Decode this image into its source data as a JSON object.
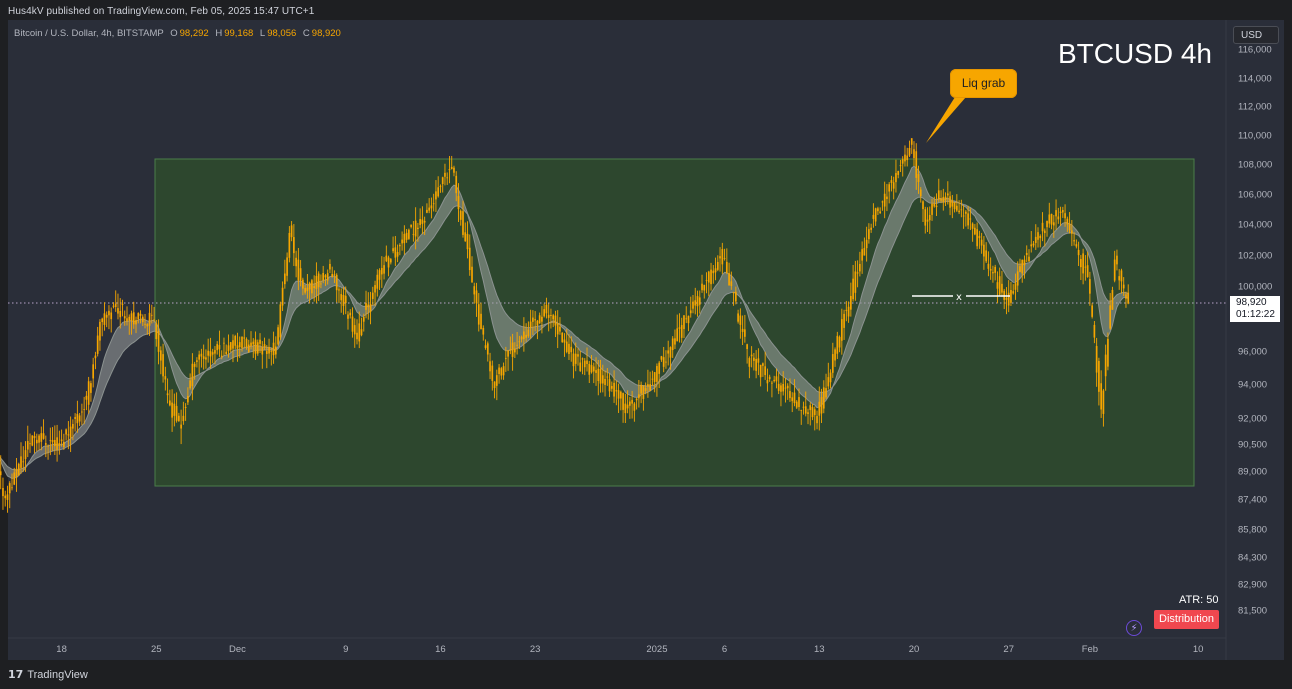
{
  "publish_bar": "Hus4kV published on TradingView.com, Feb 05, 2025 15:47 UTC+1",
  "footer_logo_text": "TradingView",
  "legend": {
    "symbol": "Bitcoin / U.S. Dollar, 4h, BITSTAMP",
    "o_key": "O",
    "o_val": "98,292",
    "h_key": "H",
    "h_val": "99,168",
    "l_key": "L",
    "l_val": "98,056",
    "c_key": "C",
    "c_val": "98,920"
  },
  "title": "BTCUSD 4h",
  "currency_button": "USD",
  "last_price": "98,920",
  "countdown": "01:12:22",
  "annotation": "Liq grab",
  "atr_label": "ATR: 50",
  "badge_label": "Distribution",
  "colors": {
    "background": "#2a2e39",
    "candle": "#f7a600",
    "range_box": "#2d4a2e",
    "range_border": "#4a7d49",
    "ma_band": "#9ca3a0",
    "callout": "#f7a600",
    "badge": "#f0474f"
  },
  "chart_data": {
    "type": "candlestick",
    "title": "BTCUSD 4h",
    "y_axis_ticks": [
      "116,000",
      "114,000",
      "112,000",
      "110,000",
      "108,000",
      "106,000",
      "104,000",
      "102,000",
      "100,000",
      "96,000",
      "94,000",
      "92,000",
      "90,500",
      "89,000",
      "87,400",
      "85,800",
      "84,300",
      "82,900",
      "81,500"
    ],
    "x_axis_ticks": [
      "18",
      "25",
      "Dec",
      "9",
      "16",
      "23",
      "2025",
      "6",
      "13",
      "20",
      "27",
      "Feb",
      "10"
    ],
    "range_box": {
      "low": 88300,
      "high": 108400,
      "start": "Nov 25",
      "end": "Feb 10"
    },
    "liq_grab_high": 109300,
    "swing_low_line": {
      "price": 99000,
      "start": "Jan 20",
      "end": "Jan 27"
    },
    "last_close": 98920,
    "price_path": [
      {
        "date": "Nov 13",
        "price": 90000
      },
      {
        "date": "Nov 14",
        "price": 87500
      },
      {
        "date": "Nov 16",
        "price": 91000
      },
      {
        "date": "Nov 18",
        "price": 90500
      },
      {
        "date": "Nov 20",
        "price": 93000
      },
      {
        "date": "Nov 21",
        "price": 97500
      },
      {
        "date": "Nov 22",
        "price": 98800
      },
      {
        "date": "Nov 24",
        "price": 97800
      },
      {
        "date": "Nov 25",
        "price": 98000
      },
      {
        "date": "Nov 26",
        "price": 93000
      },
      {
        "date": "Nov 27",
        "price": 91500
      },
      {
        "date": "Nov 28",
        "price": 95500
      },
      {
        "date": "Dec 01",
        "price": 96500
      },
      {
        "date": "Dec 04",
        "price": 96000
      },
      {
        "date": "Dec 05",
        "price": 103500
      },
      {
        "date": "Dec 06",
        "price": 99500
      },
      {
        "date": "Dec 08",
        "price": 101000
      },
      {
        "date": "Dec 10",
        "price": 97000
      },
      {
        "date": "Dec 12",
        "price": 101500
      },
      {
        "date": "Dec 15",
        "price": 104500
      },
      {
        "date": "Dec 17",
        "price": 107800
      },
      {
        "date": "Dec 19",
        "price": 98000
      },
      {
        "date": "Dec 20",
        "price": 94000
      },
      {
        "date": "Dec 22",
        "price": 97000
      },
      {
        "date": "Dec 24",
        "price": 98500
      },
      {
        "date": "Dec 26",
        "price": 95500
      },
      {
        "date": "Dec 28",
        "price": 94500
      },
      {
        "date": "Dec 30",
        "price": 92500
      },
      {
        "date": "Jan 01",
        "price": 94500
      },
      {
        "date": "Jan 03",
        "price": 97500
      },
      {
        "date": "Jan 06",
        "price": 102000
      },
      {
        "date": "Jan 08",
        "price": 95500
      },
      {
        "date": "Jan 10",
        "price": 94000
      },
      {
        "date": "Jan 13",
        "price": 92000
      },
      {
        "date": "Jan 15",
        "price": 98000
      },
      {
        "date": "Jan 17",
        "price": 104000
      },
      {
        "date": "Jan 20",
        "price": 109300
      },
      {
        "date": "Jan 21",
        "price": 104000
      },
      {
        "date": "Jan 22",
        "price": 106000
      },
      {
        "date": "Jan 24",
        "price": 104500
      },
      {
        "date": "Jan 27",
        "price": 99000
      },
      {
        "date": "Jan 29",
        "price": 103000
      },
      {
        "date": "Jan 31",
        "price": 105000
      },
      {
        "date": "Feb 02",
        "price": 100500
      },
      {
        "date": "Feb 03",
        "price": 92500
      },
      {
        "date": "Feb 04",
        "price": 101500
      },
      {
        "date": "Feb 05",
        "price": 98920
      }
    ]
  }
}
